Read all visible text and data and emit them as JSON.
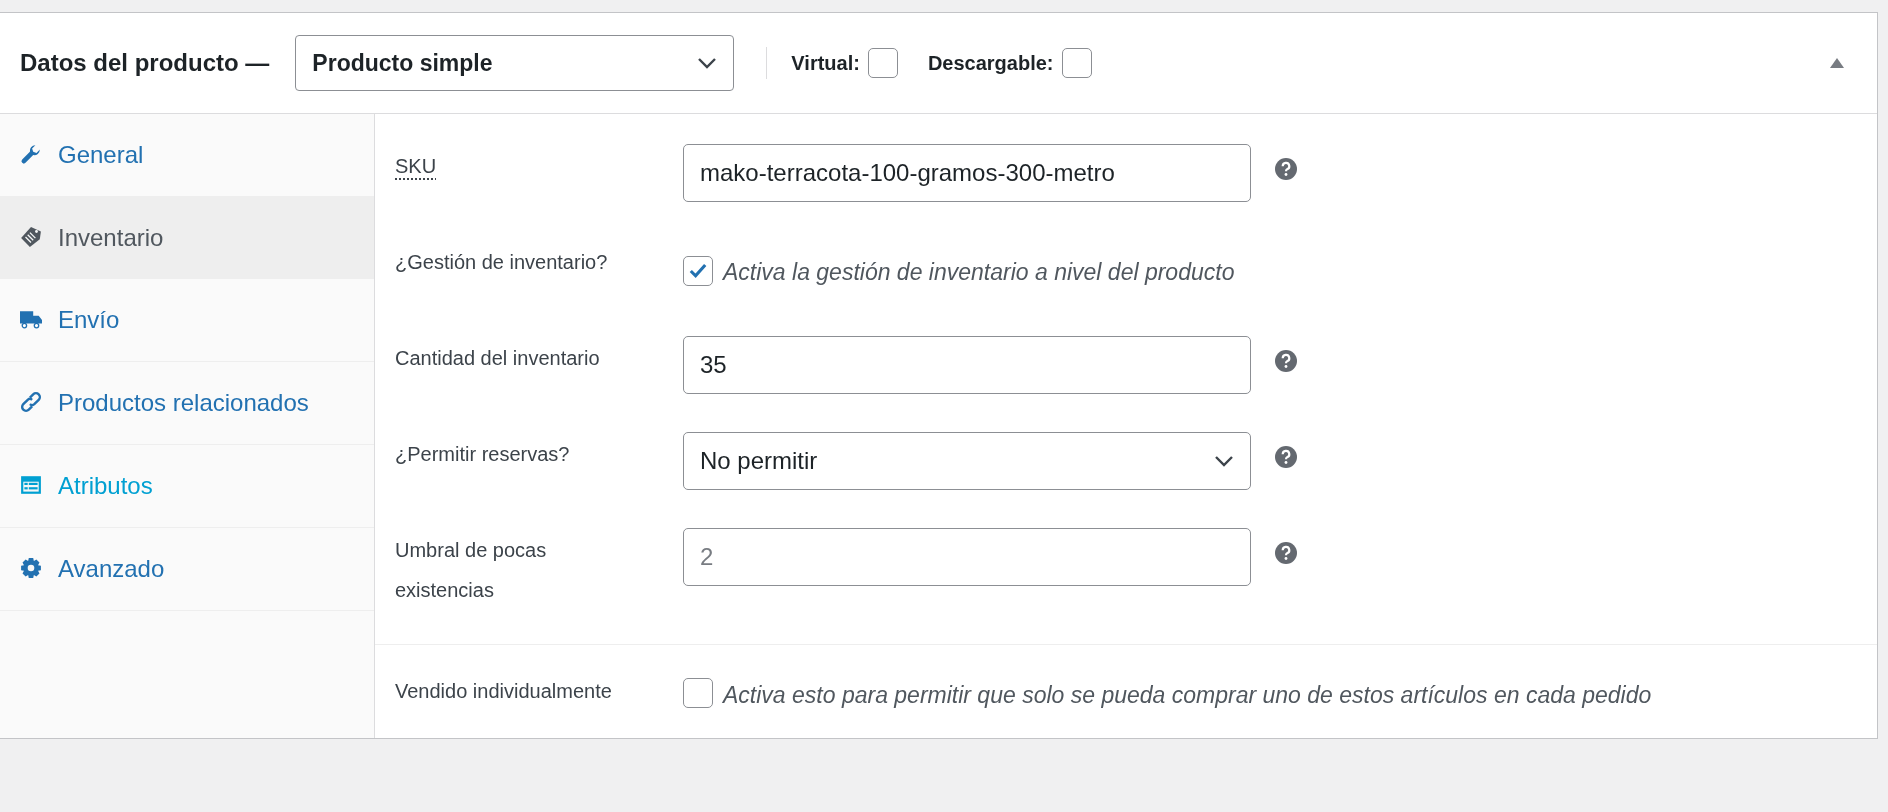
{
  "header": {
    "title": "Datos del producto —",
    "product_type": {
      "value": "Producto simple"
    },
    "options": [
      {
        "label": "Virtual:",
        "checked": false
      },
      {
        "label": "Descargable:",
        "checked": false
      }
    ],
    "expanded": true
  },
  "tabs": [
    {
      "kind": "wrench",
      "label": "General",
      "selected": false,
      "hovered": false
    },
    {
      "kind": "tag",
      "label": "Inventario",
      "selected": true,
      "hovered": false
    },
    {
      "kind": "truck",
      "label": "Envío",
      "selected": false,
      "hovered": false
    },
    {
      "kind": "link",
      "label": "Productos relacionados",
      "selected": false,
      "hovered": false
    },
    {
      "kind": "list",
      "label": "Atributos",
      "selected": false,
      "hovered": true
    },
    {
      "kind": "gear",
      "label": "Avanzado",
      "selected": false,
      "hovered": false
    }
  ],
  "groups": [
    [
      {
        "kind": "text",
        "label": "SKU",
        "value": "mako-terracota-100-gramos-300-metro"
      },
      {
        "kind": "checkbox",
        "label": "¿Gestión de inventario?",
        "checked": true,
        "description": "Activa la gestión de inventario a nivel del producto"
      },
      {
        "kind": "text",
        "label": "Cantidad del inventario",
        "value": "35"
      },
      {
        "kind": "select",
        "label": "¿Permitir reservas?",
        "value": "No permitir"
      },
      {
        "kind": "text",
        "label": "Umbral de pocas existencias",
        "placeholder": "2"
      }
    ],
    [
      {
        "kind": "checkbox",
        "label": "Vendido individualmente",
        "checked": false,
        "description": "Activa esto para permitir que solo se pueda comprar uno de estos artículos en cada pedido"
      }
    ]
  ]
}
